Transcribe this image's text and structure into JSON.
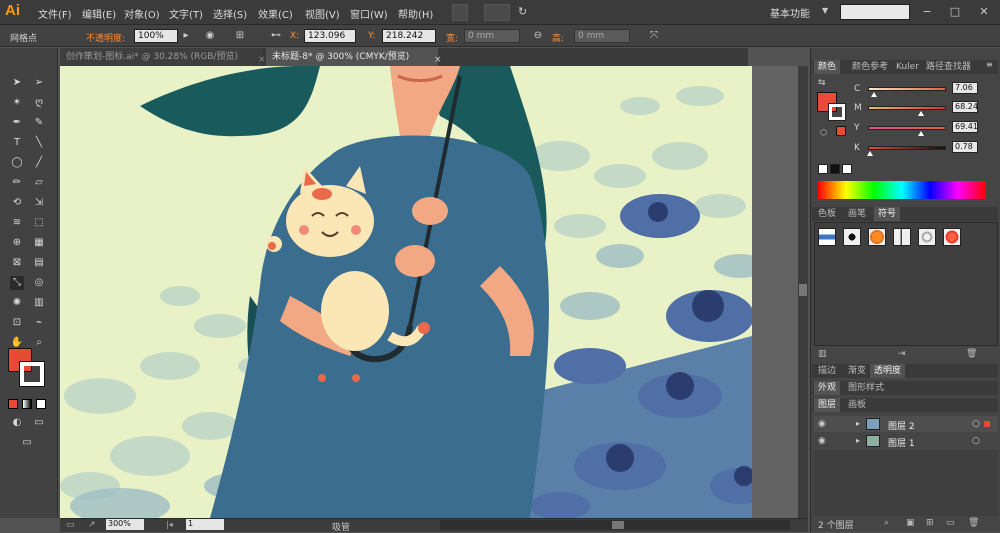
{
  "app": {
    "logo": "Ai"
  },
  "menu": [
    "文件(F)",
    "编辑(E)",
    "对象(O)",
    "文字(T)",
    "选择(S)",
    "效果(C)",
    "视图(V)",
    "窗口(W)",
    "帮助(H)"
  ],
  "workspace": "基本功能",
  "control": {
    "selection_label": "网格点",
    "opacity_label": "不透明度:",
    "opacity_value": "100%",
    "x_label": "X:",
    "x_value": "123.096",
    "y_label": "Y:",
    "y_value": "218.242",
    "w_label": "宽:",
    "w_value": "0 mm",
    "h_label": "高:",
    "h_value": "0 mm"
  },
  "tabs": [
    {
      "label": "创作策划-图标.ai* @ 30.28% (RGB/预览)",
      "active": false
    },
    {
      "label": "未标题-8* @ 300% (CMYK/预览)",
      "active": true
    }
  ],
  "color_panel": {
    "tabs": [
      "颜色",
      "颜色参考",
      "Kuler",
      "路径查找器"
    ],
    "channels": [
      {
        "name": "C",
        "value": "7.06",
        "fraction": 0.07
      },
      {
        "name": "M",
        "value": "68.24",
        "fraction": 0.68
      },
      {
        "name": "Y",
        "value": "69.41",
        "fraction": 0.69
      },
      {
        "name": "K",
        "value": "0.78",
        "fraction": 0.01
      }
    ],
    "fill_color": "#e84b35"
  },
  "swatch_panel": {
    "tabs": [
      "色板",
      "画笔",
      "符号"
    ]
  },
  "stroke_panel": {
    "tabs": [
      "描边",
      "渐变",
      "透明度"
    ]
  },
  "appearance_panel": {
    "tabs": [
      "外观",
      "图形样式"
    ]
  },
  "layers_panel": {
    "tabs": [
      "图层",
      "画板"
    ],
    "layers": [
      {
        "name": "图层 2"
      },
      {
        "name": "图层 1"
      }
    ],
    "count": "2 个图层"
  },
  "status": {
    "zoom": "300%",
    "page": "1",
    "tool": "吸管"
  }
}
